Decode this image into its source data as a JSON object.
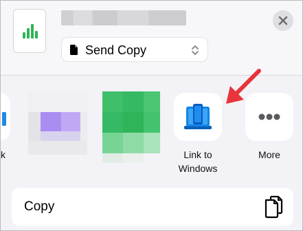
{
  "share_sheet": {
    "send_mode": {
      "label": "Send Copy"
    },
    "apps": [
      {
        "label": "k"
      },
      {
        "label": "Link to\nWindows"
      },
      {
        "label": "More"
      }
    ],
    "actions": [
      {
        "label": "Copy"
      }
    ]
  },
  "colors": {
    "accent_green": "#2fb457",
    "link_windows_blue": "#0f6fd8",
    "arrow_red": "#e8343a"
  },
  "icons": [
    "numbers-file-icon",
    "document-icon",
    "chevron-up-down-icon",
    "close-icon",
    "link-to-windows-icon",
    "more-icon",
    "copy-icon",
    "annotation-arrow-icon"
  ]
}
